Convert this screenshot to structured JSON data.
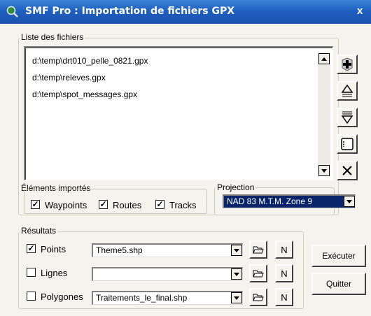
{
  "window": {
    "title": "SMF Pro : Importation de fichiers GPX",
    "close_label": "x"
  },
  "files": {
    "legend": "Liste des fichiers",
    "items": [
      "d:\\temp\\drt010_pelle_0821.gpx",
      "d:\\temp\\releves.gpx",
      "d:\\temp\\spot_messages.gpx"
    ]
  },
  "imported": {
    "legend": "Éléments importés",
    "waypoints": {
      "label": "Waypoints",
      "checked": true
    },
    "routes": {
      "label": "Routes",
      "checked": true
    },
    "tracks": {
      "label": "Tracks",
      "checked": true
    }
  },
  "projection": {
    "legend": "Projection",
    "selected": "NAD 83 M.T.M. Zone 9"
  },
  "results": {
    "legend": "Résultats",
    "rows": [
      {
        "label": "Points",
        "checked": true,
        "value": "Theme5.shp",
        "n_label": "N"
      },
      {
        "label": "Lignes",
        "checked": false,
        "value": "",
        "n_label": "N"
      },
      {
        "label": "Polygones",
        "checked": false,
        "value": "Traitements_le_final.shp",
        "n_label": "N"
      }
    ]
  },
  "buttons": {
    "execute": "Exécuter",
    "quit": "Quitter"
  },
  "colors": {
    "titlebar": "#1f5fc0",
    "dialog_bg": "#f4f3ee",
    "selection": "#0a246a"
  },
  "icons": {
    "app": "magnifier-globe-icon",
    "add": "add-file-icon",
    "move_up": "move-up-icon",
    "move_down": "move-down-icon",
    "clear": "clear-list-icon",
    "remove": "remove-icon",
    "browse": "folder-open-icon"
  }
}
